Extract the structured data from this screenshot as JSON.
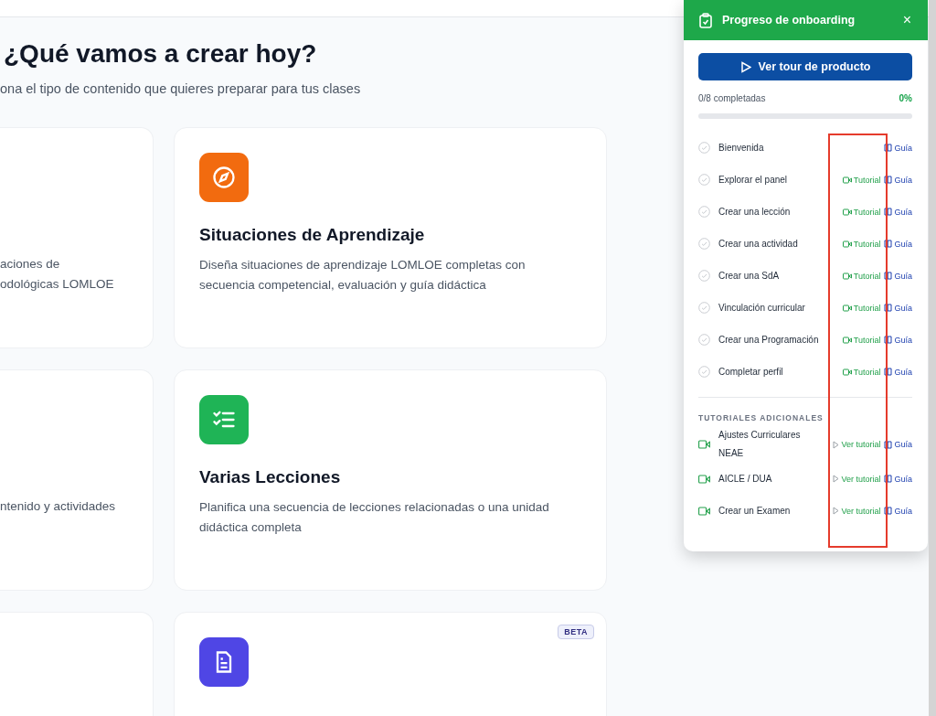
{
  "heading": "¿Qué vamos a crear hoy?",
  "subtitle": "ona el tipo de contenido que quieres preparar para tus clases",
  "left_cards": [
    {
      "lines": [
        "aciones de",
        "odológicas LOMLOE"
      ]
    },
    {
      "lines": [
        "ntenido y actividades"
      ]
    }
  ],
  "cards": [
    {
      "color": "#f26b0f",
      "title": "Situaciones de Aprendizaje",
      "description": "Diseña situaciones de aprendizaje LOMLOE completas con secuencia competencial, evaluación y guía didáctica"
    },
    {
      "color": "#1fb456",
      "title": "Varias Lecciones",
      "description": "Planifica una secuencia de lecciones relacionadas o una unidad didáctica completa"
    },
    {
      "color": "#4f46e5",
      "badge": "BETA"
    }
  ],
  "onboarding": {
    "title": "Progreso de onboarding",
    "close": "×",
    "tour_button": "Ver tour de producto",
    "progress_label": "0/8 completadas",
    "percent": "0%",
    "level": 0,
    "steps": [
      {
        "label": "Bienvenida",
        "done": false,
        "guide": "Guía"
      },
      {
        "label": "Explorar el panel",
        "done": false,
        "tutorial": "Tutorial",
        "guide": "Guía"
      },
      {
        "label": "Crear una lección",
        "done": false,
        "tutorial": "Tutorial",
        "guide": "Guía"
      },
      {
        "label": "Crear una actividad",
        "done": false,
        "tutorial": "Tutorial",
        "guide": "Guía"
      },
      {
        "label": "Crear una SdA",
        "done": false,
        "tutorial": "Tutorial",
        "guide": "Guía"
      },
      {
        "label": "Vinculación curricular",
        "done": false,
        "tutorial": "Tutorial",
        "guide": "Guía"
      },
      {
        "label": "Crear una Programación",
        "done": false,
        "tutorial": "Tutorial",
        "guide": "Guía"
      },
      {
        "label": "Completar perfil",
        "done": false,
        "tutorial": "Tutorial",
        "guide": "Guía"
      }
    ],
    "extra_heading": "TUTORIALES ADICIONALES",
    "extras": [
      {
        "label": "Ajustes Curriculares NEAE",
        "tutorial": "Ver tutorial",
        "guide": "Guía"
      },
      {
        "label": "AICLE / DUA",
        "tutorial": "Ver tutorial",
        "guide": "Guía"
      },
      {
        "label": "Crear un Examen",
        "tutorial": "Ver tutorial",
        "guide": "Guía"
      }
    ]
  }
}
